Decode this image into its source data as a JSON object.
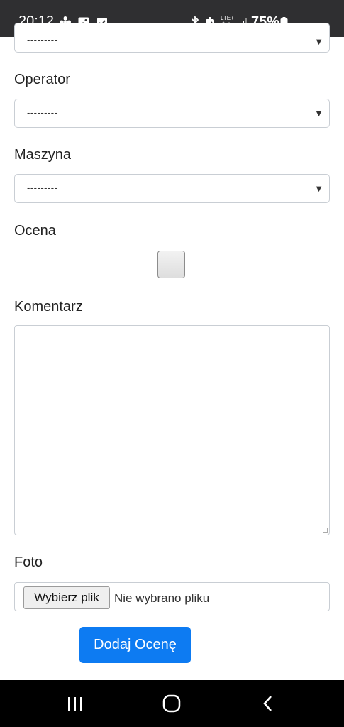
{
  "status_bar": {
    "time": "20:12",
    "battery_percent": "75%",
    "icons": [
      "fan-icon",
      "image-icon",
      "check-icon",
      "bluetooth-icon",
      "alarm-icon",
      "lte-icon",
      "signal-icon",
      "battery-icon"
    ]
  },
  "form": {
    "top_select_value": "---------",
    "operator": {
      "label": "Operator",
      "value": "---------"
    },
    "maszyna": {
      "label": "Maszyna",
      "value": "---------"
    },
    "ocena": {
      "label": "Ocena",
      "checked": false
    },
    "komentarz": {
      "label": "Komentarz",
      "value": ""
    },
    "foto": {
      "label": "Foto",
      "button_label": "Wybierz plik",
      "status_text": "Nie wybrano pliku"
    },
    "submit_label": "Dodaj Ocenę"
  },
  "nav_bar": {
    "icons": [
      "recent-apps-icon",
      "home-icon",
      "back-icon"
    ]
  },
  "colors": {
    "accent": "#0d7bf2",
    "status_bar_bg": "#2f2f31",
    "nav_bar_bg": "#000000"
  }
}
